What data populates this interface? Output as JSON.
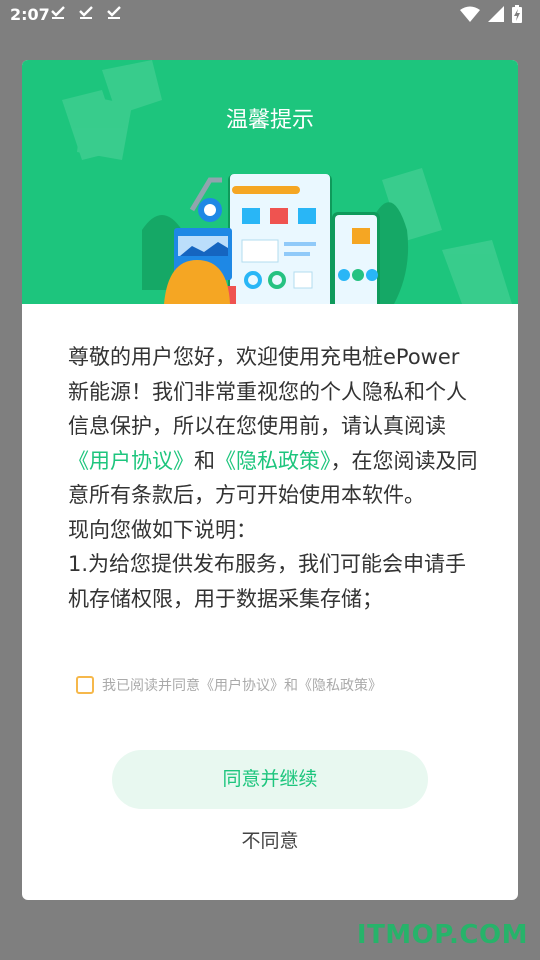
{
  "statusbar": {
    "time": "2:07",
    "notification_icons": [
      "download-done-icon",
      "download-done-icon",
      "download-done-icon"
    ],
    "right_icons": [
      "wifi-icon",
      "signal-icon",
      "battery-charging-icon"
    ]
  },
  "dialog": {
    "title": "温馨提示",
    "paragraph1_part1": "尊敬的用户您好，欢迎使用充电桩ePower新能源！我们非常重视您的个人隐私和个人信息保护，所以在您使用前，请认真阅读",
    "user_agreement_link": "《用户协议》",
    "and_text": "和",
    "privacy_policy_link": "《隐私政策》",
    "paragraph1_part2": "，在您阅读及同意所有条款后，方可开始使用本软件。",
    "paragraph2": "现向您做如下说明：",
    "paragraph3": "1.为给您提供发布服务，我们可能会申请手机存储权限，用于数据采集存储；",
    "agree_checkbox_label": "我已阅读并同意《用户协议》和《隐私政策》",
    "agree_checked": false,
    "agree_button": "同意并继续",
    "disagree_button": "不同意"
  },
  "watermark": "ITMOP.COM",
  "colors": {
    "brand_green": "#1dc57d",
    "overlay": "#7f7f7f",
    "checkbox_border": "#f6b84b",
    "button_bg": "#e8f8f0"
  }
}
